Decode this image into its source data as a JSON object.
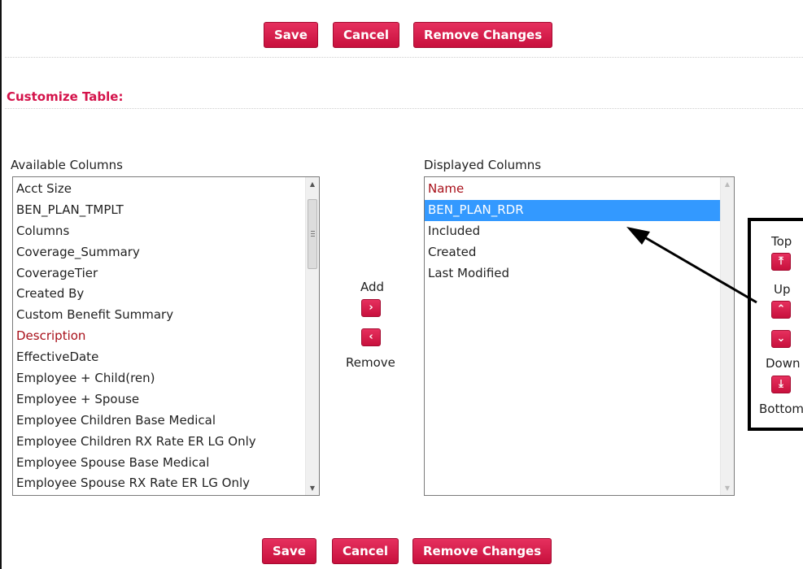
{
  "toolbar": {
    "save_label": "Save",
    "cancel_label": "Cancel",
    "remove_changes_label": "Remove Changes"
  },
  "section_title": "Customize Table:",
  "available": {
    "label": "Available Columns",
    "items": [
      "Acct Size",
      "BEN_PLAN_TMPLT",
      "Columns",
      "Coverage_Summary",
      "CoverageTier",
      "Created By",
      "Custom Benefit Summary",
      "Description",
      "EffectiveDate",
      "Employee + Child(ren)",
      "Employee + Spouse",
      "Employee Children Base Medical",
      "Employee Children RX Rate ER LG Only",
      "Employee Spouse Base Medical",
      "Employee Spouse RX Rate ER LG Only"
    ]
  },
  "displayed": {
    "label": "Displayed Columns",
    "items": [
      "Name",
      "BEN_PLAN_RDR",
      "Included",
      "Created",
      "Last Modified"
    ],
    "selected": "BEN_PLAN_RDR"
  },
  "transfer": {
    "add_label": "Add",
    "remove_label": "Remove",
    "add_glyph": "›",
    "remove_glyph": "‹"
  },
  "order": {
    "top_label": "Top",
    "up_label": "Up",
    "down_label": "Down",
    "bottom_label": "Bottom",
    "top_glyph": "⤒",
    "up_glyph": "⌃",
    "down_glyph": "⌄",
    "bottom_glyph": "⤓"
  },
  "colors": {
    "accent": "#d4124a",
    "button": "#c8103d",
    "selection": "#3399ff",
    "required_text": "#a8101a"
  }
}
